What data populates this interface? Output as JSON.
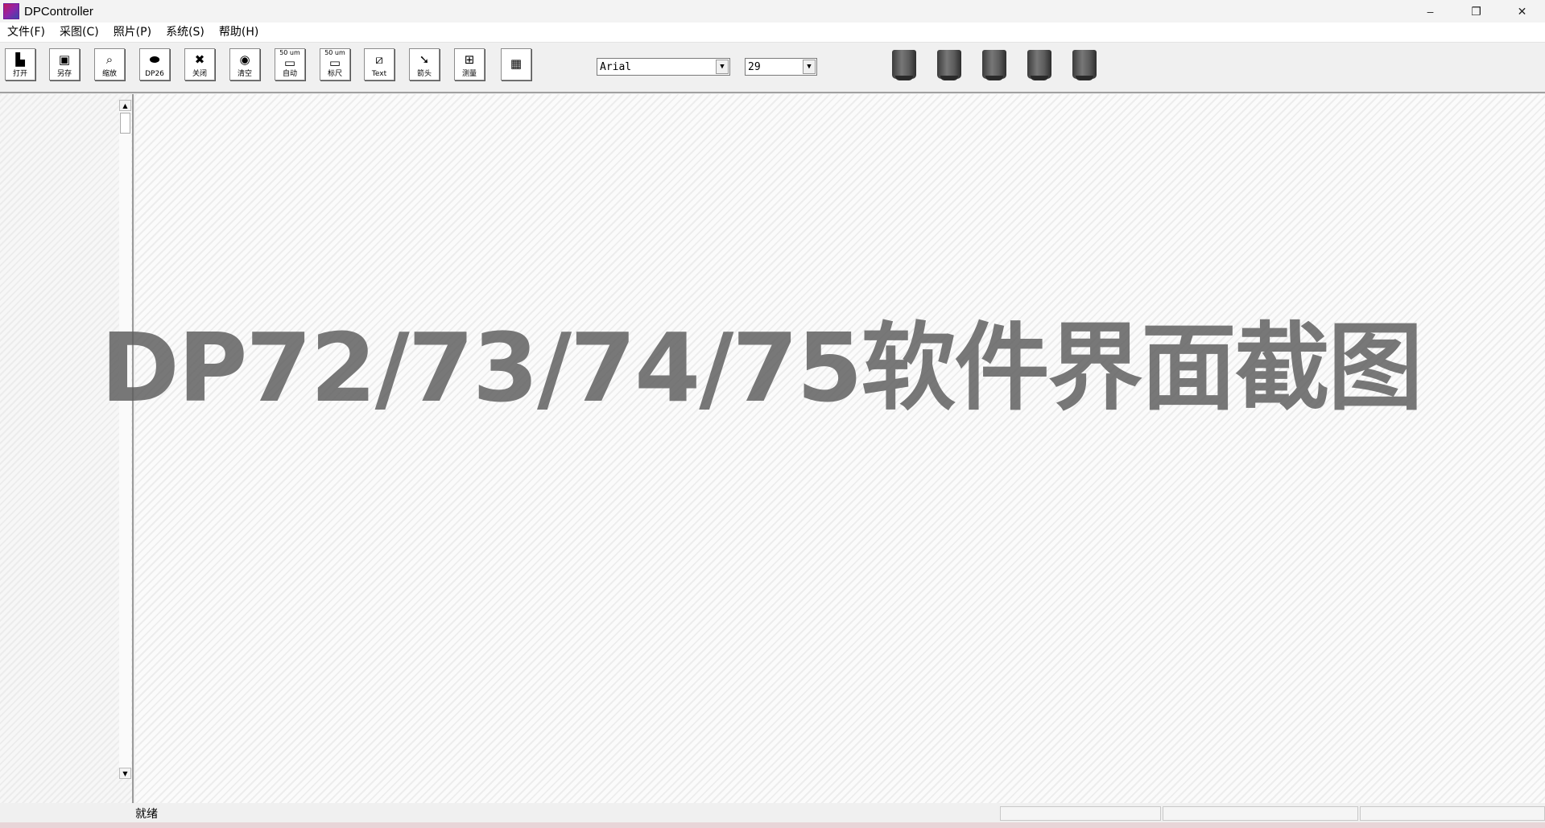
{
  "window": {
    "title": "DPController",
    "minimize_glyph": "–",
    "restore_glyph": "❐",
    "close_glyph": "✕"
  },
  "menu": {
    "items": [
      {
        "label": "文件(F)"
      },
      {
        "label": "采图(C)"
      },
      {
        "label": "照片(P)"
      },
      {
        "label": "系统(S)"
      },
      {
        "label": "帮助(H)"
      }
    ]
  },
  "toolbar": {
    "open_label": "打开",
    "saveas_label": "另存",
    "zoom_label": "缩放",
    "dp26_label": "DP26",
    "close_label": "关闭",
    "clear_label": "清空",
    "auto_top": "50 um",
    "auto_label": "自动",
    "scale_top": "50 um",
    "scale_label": "标尺",
    "text_label": "Text",
    "arrow_label": "箭头",
    "measure_label": "测量",
    "font_value": "Arial",
    "size_value": "29",
    "icons": [
      "open-icon",
      "save-icon",
      "zoom-icon",
      "camera-icon",
      "close-icon",
      "clear-icon",
      "auto-scale-icon",
      "scale-bar-icon",
      "text-icon",
      "arrow-icon",
      "measure-icon",
      "layout-icon"
    ]
  },
  "objectives": {
    "count": 5
  },
  "watermark": {
    "text": "DP72/73/74/75软件界面截图"
  },
  "statusbar": {
    "text": "就绪"
  }
}
